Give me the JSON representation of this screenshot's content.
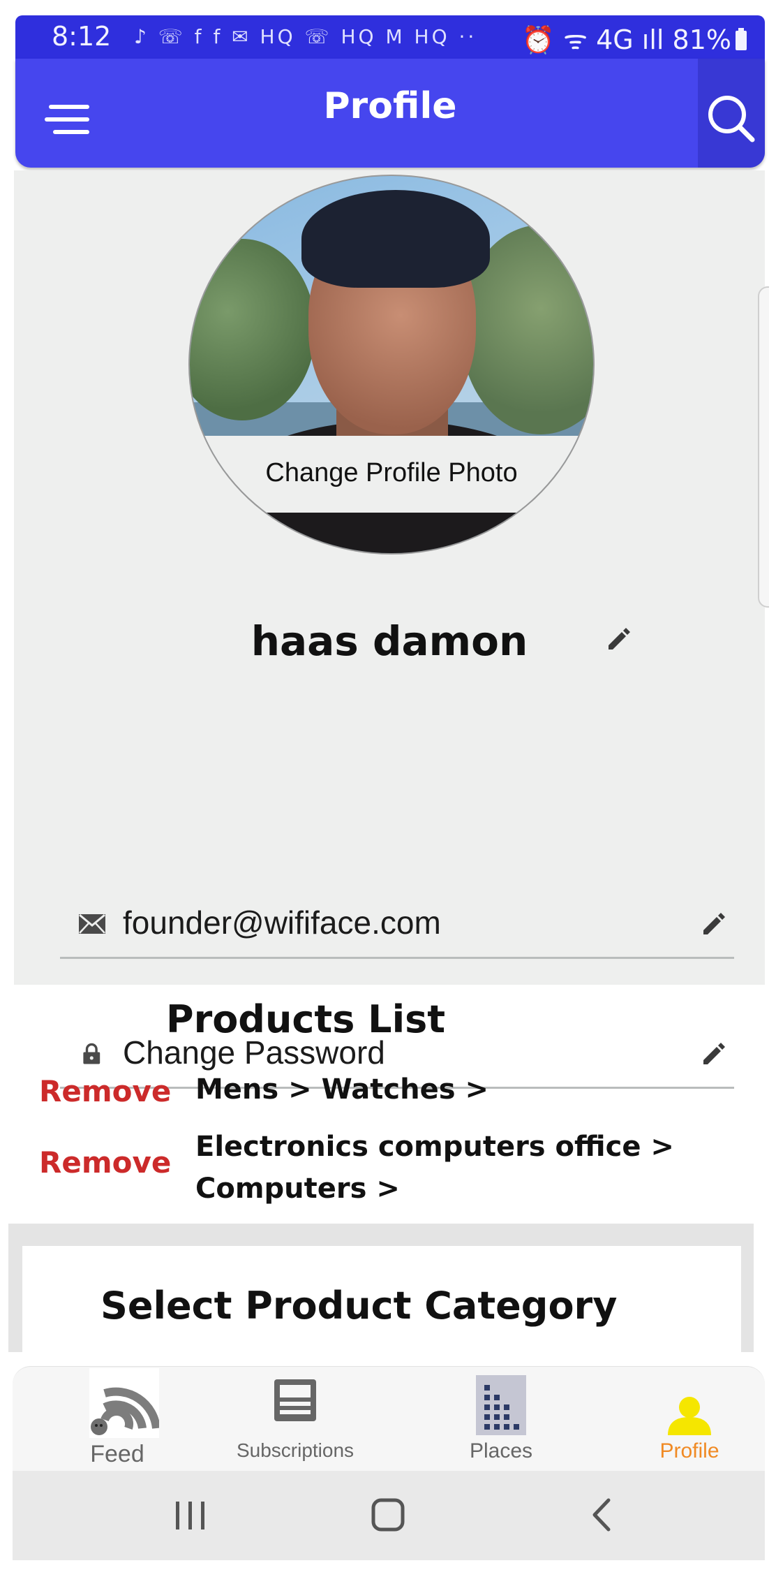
{
  "status_bar": {
    "time": "8:12",
    "notifications": "♪ ☏ f f ✉ HQ ☏ HQ M HQ ··",
    "right": "⏰ ᯤ 4G ıll 81%"
  },
  "app_bar": {
    "title": "Profile"
  },
  "profile": {
    "change_photo_label": "Change Profile Photo",
    "name": "haas damon",
    "email": "founder@wififace.com",
    "change_password_label": "Change Password"
  },
  "products": {
    "title": "Products List",
    "items": [
      {
        "remove_label": "Remove",
        "path": "Mens > Watches >"
      },
      {
        "remove_label": "Remove",
        "path": "Electronics computers office > Computers >"
      }
    ]
  },
  "select_category": {
    "label": "Select Product Category"
  },
  "bottom_nav": {
    "items": [
      {
        "label": "Feed",
        "icon": "wifi-feed-icon"
      },
      {
        "label": "Subscriptions",
        "icon": "newspaper-icon"
      },
      {
        "label": "Places",
        "icon": "building-icon"
      },
      {
        "label": "Profile",
        "icon": "person-icon"
      }
    ],
    "active_color": "#f08a24",
    "profile_icon_color": "#f5e600"
  },
  "colors": {
    "app_bar": "#4646ee",
    "status_bar": "#2f2fdd",
    "remove": "#cc2a2a"
  }
}
